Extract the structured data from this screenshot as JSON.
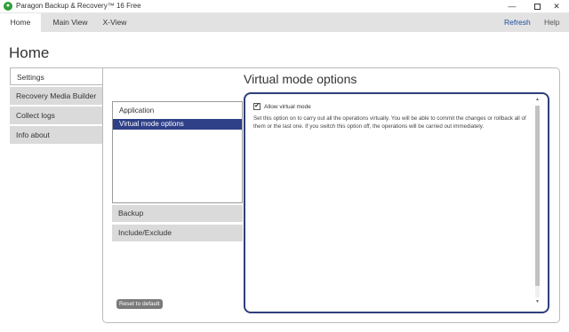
{
  "window": {
    "title": "Paragon Backup & Recovery™ 16 Free",
    "icon": "paragon-logo-icon",
    "minimize_glyph": "—",
    "close_glyph": "✕"
  },
  "menubar": {
    "tabs": [
      {
        "label": "Home",
        "active": true
      },
      {
        "label": "Main View",
        "active": false
      },
      {
        "label": "X-View",
        "active": false
      }
    ],
    "refresh_label": "Refresh",
    "help_label": "Help",
    "accent_color": "#1f4e9c"
  },
  "page": {
    "title": "Home"
  },
  "sidebar": {
    "items": [
      {
        "label": "Settings",
        "active": true
      },
      {
        "label": "Recovery Media Builder",
        "active": false
      },
      {
        "label": "Collect logs",
        "active": false
      },
      {
        "label": "Info about",
        "active": false
      }
    ]
  },
  "settings": {
    "section_title": "Virtual mode options",
    "categories": [
      {
        "label": "Application",
        "selected": false
      },
      {
        "label": "Virtual mode options",
        "selected": true
      }
    ],
    "groups": [
      {
        "label": "Backup"
      },
      {
        "label": "Include/Exclude"
      }
    ],
    "reset_label": "Reset to default",
    "selection_color": "#2f3f88",
    "options": {
      "allow_virtual_mode": {
        "label": "Allow virtual mode",
        "checked": true,
        "check_glyph": "✔"
      },
      "description": "Set this option on to carry out all the operations virtually. You will be able to commit the changes or rollback all of them or the last one. If you switch this option off, the operations will be carried out immediately."
    },
    "scroll_up_glyph": "▲",
    "scroll_down_glyph": "▼"
  }
}
